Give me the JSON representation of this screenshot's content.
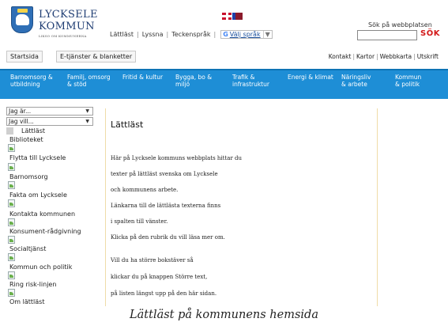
{
  "header": {
    "brand_line1": "LYCKSELE",
    "brand_line2": "KOMMUN",
    "brand_sub": "LIKSO OM KOMMUNERNA",
    "links": [
      "Lättläst",
      "Lyssna",
      "Teckenspråk"
    ],
    "translate_label": "Välj språk",
    "translate_g": "G",
    "dropdown_caret": "▼",
    "search_label": "Sök på webbplatsen",
    "search_value": "",
    "search_button": "SÖK"
  },
  "tabs": [
    "Startsida",
    "E-tjänster & blanketter"
  ],
  "utility_links": [
    "Kontakt",
    "Kartor",
    "Webbkarta",
    "Utskrift"
  ],
  "nav": [
    {
      "line1": "Barnomsorg &",
      "line2": "utbildning"
    },
    {
      "line1": "Familj, omsorg",
      "line2": "& stöd"
    },
    {
      "line1": "Fritid & kultur",
      "line2": ""
    },
    {
      "line1": "Bygga, bo &",
      "line2": "miljö"
    },
    {
      "line1": "Trafik &",
      "line2": "infrastruktur"
    },
    {
      "line1": "Energi & klimat",
      "line2": ""
    },
    {
      "line1": "Näringsliv",
      "line2": "& arbete"
    },
    {
      "line1": "Kommun",
      "line2": "& politik"
    }
  ],
  "sidebar": {
    "select1": "Jag är...",
    "select2": "Jag vill...",
    "current": "Lättläst",
    "items": [
      "Biblioteket",
      "Flytta till Lycksele",
      "Barnomsorg",
      "Fakta om Lycksele",
      "Kontakta kommunen",
      "Konsument-rådgivning",
      "Socialtjänst",
      "Kommun och politik",
      "Ring risk-linjen",
      "Om lättläst"
    ]
  },
  "main": {
    "title": "Lättläst",
    "paragraphs": [
      "Här på Lycksele kommuns webbplats hittar du",
      "texter på lättläst svenska om Lycksele",
      "och kommunens arbete.",
      "Länkarna till de lättlästa texterna finns",
      "i spalten till vänster.",
      "Klicka på den rubrik du vill läsa mer om.",
      "Vill du ha större bokstäver så",
      "klickar du på knappen Större text,",
      "på listen längst upp på den här sidan."
    ]
  },
  "caption": "Lättläst på kommunens hemsida"
}
